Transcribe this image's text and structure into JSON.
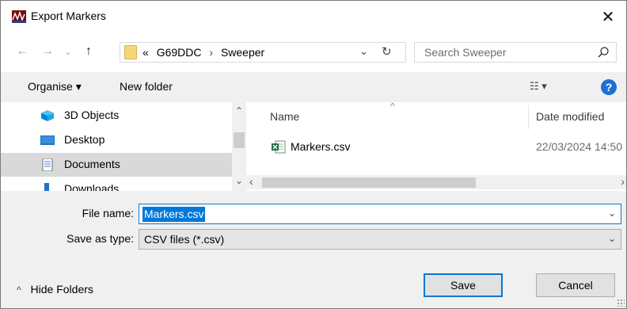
{
  "window": {
    "title": "Export Markers",
    "app_icon": "app-logo-icon",
    "close_icon": "close-icon"
  },
  "nav": {
    "back_icon": "back-arrow-icon",
    "forward_icon": "forward-arrow-icon",
    "recent_icon": "chevron-down-icon",
    "up_icon": "up-arrow-icon",
    "breadcrumb": {
      "overflow": "«",
      "items": [
        "G69DDC",
        "Sweeper"
      ],
      "separator": "›"
    },
    "refresh_icon": "refresh-icon",
    "search_placeholder": "Search Sweeper"
  },
  "toolbar": {
    "organise_label": "Organise ▾",
    "new_folder_label": "New folder",
    "view_label": "☷ ▾",
    "help_label": "?"
  },
  "nav_pane": {
    "items": [
      {
        "label": "3D Objects",
        "icon": "cube-icon",
        "selected": false
      },
      {
        "label": "Desktop",
        "icon": "desktop-icon",
        "selected": false
      },
      {
        "label": "Documents",
        "icon": "documents-icon",
        "selected": true
      },
      {
        "label": "Downloads",
        "icon": "downloads-icon",
        "selected": false
      }
    ]
  },
  "file_list": {
    "columns": [
      "Name",
      "Date modified"
    ],
    "sort_indicator": "^",
    "files": [
      {
        "name": "Markers.csv",
        "date_modified": "22/03/2024 14:50",
        "icon": "excel-csv-icon"
      }
    ]
  },
  "form": {
    "file_name_label": "File name:",
    "file_name_value": "Markers.csv",
    "save_type_label": "Save as type:",
    "save_type_value": "CSV files (*.csv)"
  },
  "footer": {
    "hide_folders_label": "Hide Folders",
    "save_label": "Save",
    "cancel_label": "Cancel"
  },
  "colors": {
    "accent": "#0078d7",
    "selection": "#d9d9d9",
    "help": "#1c6fd4"
  }
}
